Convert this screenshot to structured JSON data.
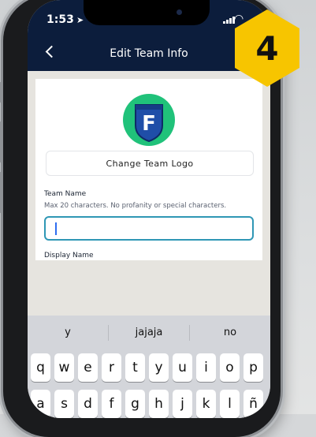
{
  "status": {
    "time": "1:53"
  },
  "nav": {
    "title": "Edit Team Info"
  },
  "form": {
    "change_logo_label": "Change Team Logo",
    "team_name_label": "Team Name",
    "team_name_hint": "Max 20 characters. No profanity or special characters.",
    "team_name_value": "",
    "display_name_label": "Display Name",
    "logo_letter": "F"
  },
  "keyboard": {
    "suggestions": [
      "y",
      "jajaja",
      "no"
    ],
    "row1": [
      "q",
      "w",
      "e",
      "r",
      "t",
      "y",
      "u",
      "i",
      "o",
      "p"
    ],
    "row2": [
      "a",
      "s",
      "d",
      "f",
      "g",
      "h",
      "j",
      "k",
      "l",
      "ñ"
    ]
  },
  "badge": {
    "number": "4"
  },
  "colors": {
    "navy": "#0c1d3c",
    "accent": "#2f97b5",
    "logo_green": "#20c27a",
    "logo_blue": "#1f4ea8",
    "badge_yellow": "#f7c500"
  }
}
